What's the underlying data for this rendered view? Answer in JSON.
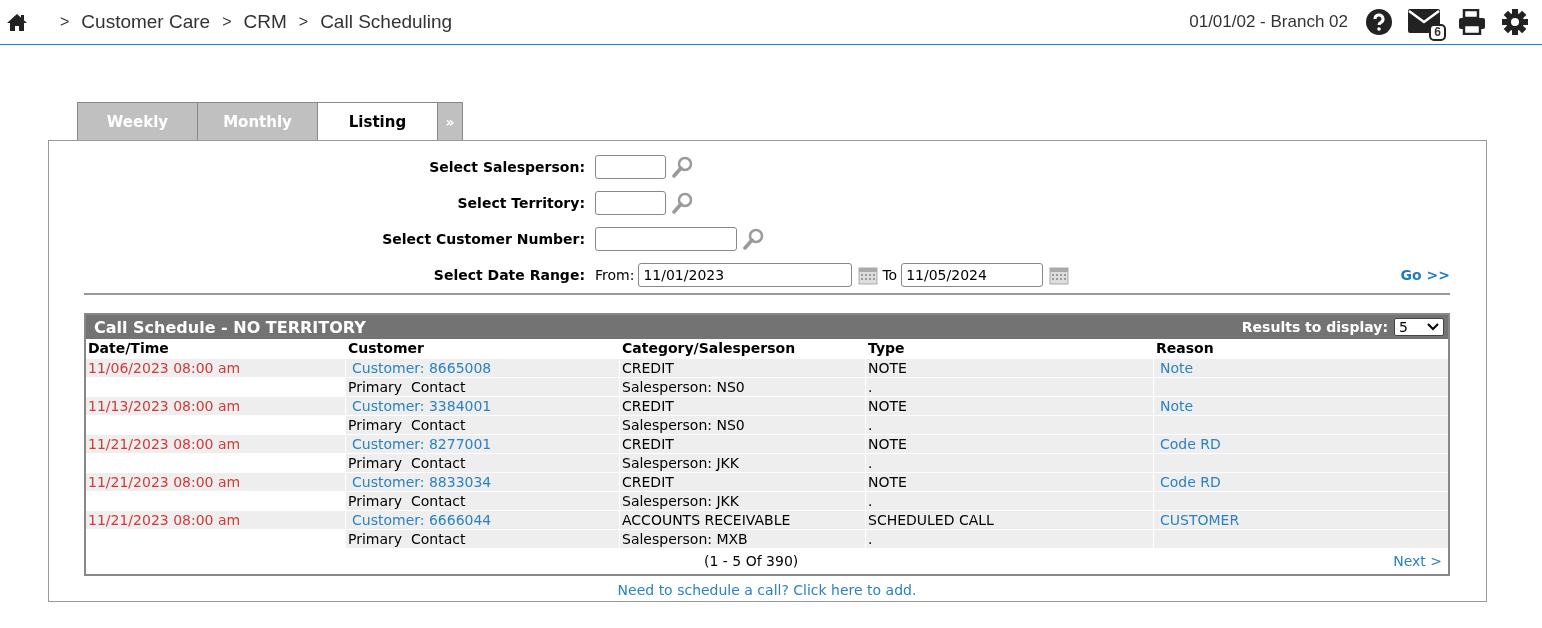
{
  "breadcrumb": [
    {
      "separator": ">",
      "label": "Customer Care"
    },
    {
      "separator": ">",
      "label": "CRM"
    },
    {
      "separator": ">",
      "label": "Call Scheduling"
    }
  ],
  "branch": "01/01/02 - Branch 02",
  "mail_count": "6",
  "tabs": [
    {
      "label": "Weekly",
      "selected": false
    },
    {
      "label": "Monthly",
      "selected": false
    },
    {
      "label": "Listing",
      "selected": true
    }
  ],
  "more_tabs": "»",
  "filters": [
    {
      "kind": "lookup",
      "label": "Select Salesperson:"
    },
    {
      "kind": "lookup",
      "label": "Select Territory:"
    },
    {
      "kind": "widelookup",
      "label": "Select Customer Number:"
    },
    {
      "kind": "daterange",
      "label": "Select Date Range:",
      "from_label": "From:",
      "from": "11/01/2023",
      "to_label": "To",
      "to": "11/05/2024"
    }
  ],
  "go": "Go >>",
  "schedule": {
    "title": "Call Schedule - NO TERRITORY",
    "results_label": "Results to display:",
    "results_value": "5",
    "columns": [
      "Date/Time",
      "Customer",
      "Category/Salesperson",
      "Type",
      "Reason"
    ],
    "rows": [
      {
        "date": "11/06/2023 08:00 am",
        "customer": "Customer: 8665008",
        "category": "CREDIT",
        "type": "NOTE",
        "reason": "Note",
        "contact": "Primary  Contact",
        "salesperson": "Salesperson: NS0",
        "detail": "."
      },
      {
        "date": "11/13/2023 08:00 am",
        "customer": "Customer: 3384001",
        "category": "CREDIT",
        "type": "NOTE",
        "reason": "Note",
        "contact": "Primary  Contact",
        "salesperson": "Salesperson: NS0",
        "detail": "."
      },
      {
        "date": "11/21/2023 08:00 am",
        "customer": "Customer: 8277001",
        "category": "CREDIT",
        "type": "NOTE",
        "reason": "Code RD",
        "contact": "Primary  Contact",
        "salesperson": "Salesperson: JKK",
        "detail": "."
      },
      {
        "date": "11/21/2023 08:00 am",
        "customer": "Customer: 8833034",
        "category": "CREDIT",
        "type": "NOTE",
        "reason": "Code RD",
        "contact": "Primary  Contact",
        "salesperson": "Salesperson: JKK",
        "detail": "."
      },
      {
        "date": "11/21/2023 08:00 am",
        "customer": "Customer: 6666044",
        "category": "ACCOUNTS RECEIVABLE",
        "type": "SCHEDULED CALL",
        "reason": "CUSTOMER",
        "contact": "Primary  Contact",
        "salesperson": "Salesperson: MXB",
        "detail": "."
      }
    ],
    "pager": "(1 - 5 Of 390)",
    "next": "Next >"
  },
  "add_link": "Need to schedule a call? Click here to add."
}
